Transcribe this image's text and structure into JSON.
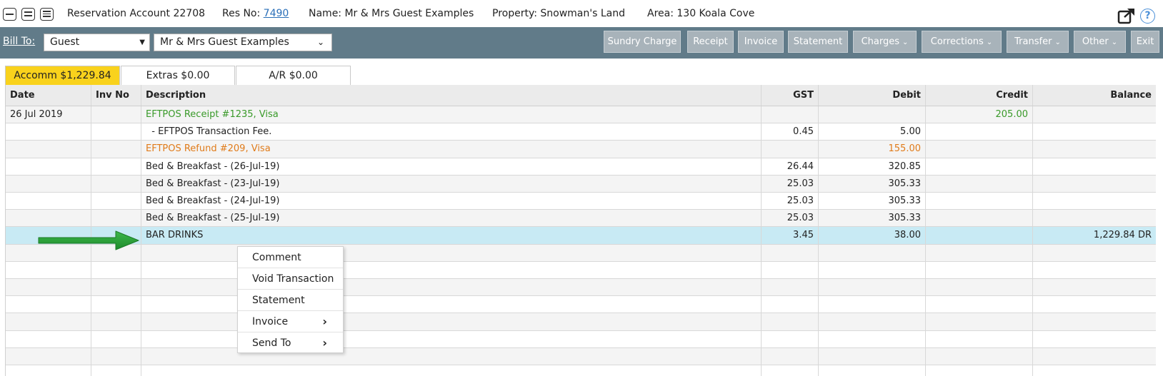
{
  "header": {
    "account": "Reservation Account 22708",
    "res_label": "Res No:",
    "res_no": "7490",
    "name": "Name: Mr & Mrs Guest Examples",
    "property": "Property: Snowman's Land",
    "area": "Area: 130 Koala Cove",
    "help_glyph": "?"
  },
  "toolbar": {
    "bill_to_label": "Bill To:",
    "bill_to_type": "Guest",
    "bill_to_name": "Mr & Mrs Guest Examples",
    "buttons": {
      "sundry": "Sundry Charge",
      "receipt": "Receipt",
      "invoice": "Invoice",
      "statement": "Statement",
      "charges": "Charges",
      "corrections": "Corrections",
      "transfer": "Transfer",
      "other": "Other",
      "exit": "Exit"
    }
  },
  "tabs": {
    "accomm": "Accomm $1,229.84",
    "extras": "Extras $0.00",
    "ar": "A/R $0.00"
  },
  "table": {
    "headers": {
      "date": "Date",
      "inv_no": "Inv No",
      "description": "Description",
      "gst": "GST",
      "debit": "Debit",
      "credit": "Credit",
      "balance": "Balance"
    },
    "rows": [
      {
        "date": "26 Jul 2019",
        "inv": "",
        "desc": "EFTPOS Receipt #1235, Visa",
        "gst": "",
        "debit": "",
        "credit": "205.00",
        "balance": "",
        "tone": "green"
      },
      {
        "date": "",
        "inv": "",
        "desc": "  - EFTPOS Transaction Fee.",
        "gst": "0.45",
        "debit": "5.00",
        "credit": "",
        "balance": "",
        "tone": ""
      },
      {
        "date": "",
        "inv": "",
        "desc": "EFTPOS Refund #209, Visa",
        "gst": "",
        "debit": "155.00",
        "credit": "",
        "balance": "",
        "tone": "orange"
      },
      {
        "date": "",
        "inv": "",
        "desc": "Bed & Breakfast - (26-Jul-19)",
        "gst": "26.44",
        "debit": "320.85",
        "credit": "",
        "balance": "",
        "tone": ""
      },
      {
        "date": "",
        "inv": "",
        "desc": "Bed & Breakfast - (23-Jul-19)",
        "gst": "25.03",
        "debit": "305.33",
        "credit": "",
        "balance": "",
        "tone": ""
      },
      {
        "date": "",
        "inv": "",
        "desc": "Bed & Breakfast - (24-Jul-19)",
        "gst": "25.03",
        "debit": "305.33",
        "credit": "",
        "balance": "",
        "tone": ""
      },
      {
        "date": "",
        "inv": "",
        "desc": "Bed & Breakfast - (25-Jul-19)",
        "gst": "25.03",
        "debit": "305.33",
        "credit": "",
        "balance": "",
        "tone": ""
      },
      {
        "date": "",
        "inv": "",
        "desc": "BAR DRINKS",
        "gst": "3.45",
        "debit": "38.00",
        "credit": "",
        "balance": "1,229.84 DR",
        "tone": "",
        "selected": true
      }
    ]
  },
  "context_menu": {
    "items": [
      "Comment",
      "Void Transaction",
      "Statement",
      "Invoice",
      "Send To"
    ]
  },
  "colors": {
    "toolbar": "#617b89",
    "active_tab": "#f9d21c",
    "selected_row": "#c8eaf4",
    "arrow": "#2e9e3a",
    "link": "#2a6fb8"
  }
}
